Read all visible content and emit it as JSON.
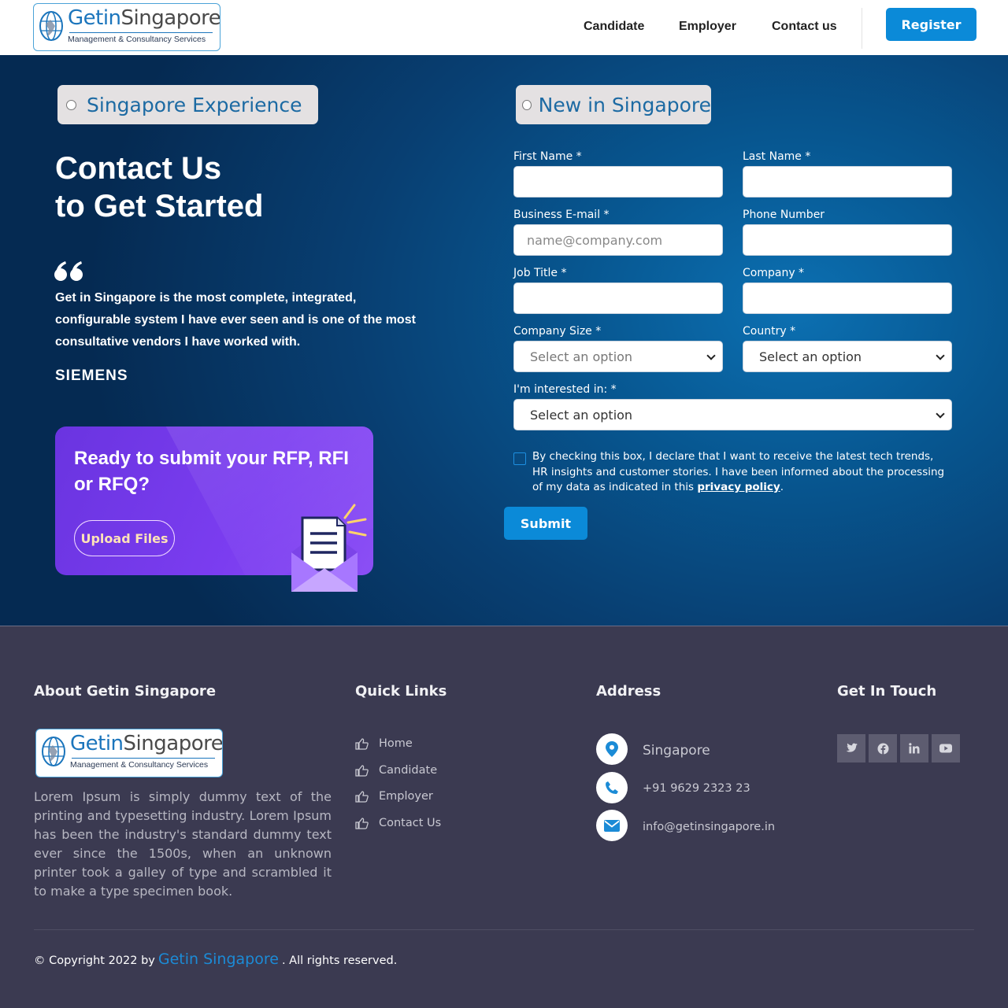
{
  "header": {
    "logo": {
      "name_part1": "Getin",
      "name_part2": "Singapore",
      "subtitle": "Management & Consultancy Services"
    },
    "nav": [
      "Candidate",
      "Employer",
      "Contact us"
    ],
    "register_label": "Register"
  },
  "hero": {
    "toggles": {
      "left": "Singapore Experience",
      "right": "New in Singapore"
    },
    "title_line1": "Contact Us",
    "title_line2": "to Get Started",
    "quote": "Get in Singapore is the most complete, integrated, configurable system I have ever seen and is one of the most consultative vendors I have worked with.",
    "quote_author": "SIEMENS",
    "rfp": {
      "title": "Ready to submit your RFP, RFI or RFQ?",
      "button": "Upload Files"
    }
  },
  "form": {
    "first_name_label": "First Name *",
    "last_name_label": "Last Name *",
    "email_label": "Business E-mail *",
    "email_placeholder": "name@company.com",
    "phone_label": "Phone Number",
    "job_title_label": "Job Title *",
    "company_label": "Company *",
    "company_size_label": "Company Size *",
    "company_size_value": "Select an option",
    "country_label": "Country *",
    "country_value": "Select an option",
    "interest_label": "I'm interested in: *",
    "interest_value": "Select an option",
    "consent_text": "By checking this box, I declare that I want to receive the latest tech trends, HR insights and customer stories. I have been informed about the processing of my data as indicated in this",
    "consent_link": "privacy policy",
    "consent_end": ".",
    "submit_label": "Submit"
  },
  "footer": {
    "about_heading": "About Getin Singapore",
    "about_text": "Lorem Ipsum is simply dummy text of the printing and typesetting industry. Lorem Ipsum has been the industry's standard dummy text ever since the 1500s, when an unknown printer took a galley of type and scrambled it to make a type specimen book.",
    "quick_links_heading": "Quick Links",
    "quick_links": [
      "Home",
      "Candidate",
      "Employer",
      "Contact Us"
    ],
    "address_heading": "Address",
    "address": {
      "location": "Singapore",
      "phone": "+91 9629 2323 23",
      "email": "info@getinsingapore.in"
    },
    "touch_heading": "Get In Touch",
    "social_icons": [
      "twitter-icon",
      "facebook-icon",
      "linkedin-icon",
      "youtube-icon"
    ],
    "copyright_prefix": "© Copyright 2022 by",
    "copyright_brand": "Getin Singapore",
    "copyright_suffix": ". All rights reserved."
  },
  "colors": {
    "accent": "#0b8ad8",
    "footer_bg": "#3b3a51",
    "rfp_purple": "#7b3df0",
    "hero_dark": "#052a52"
  }
}
